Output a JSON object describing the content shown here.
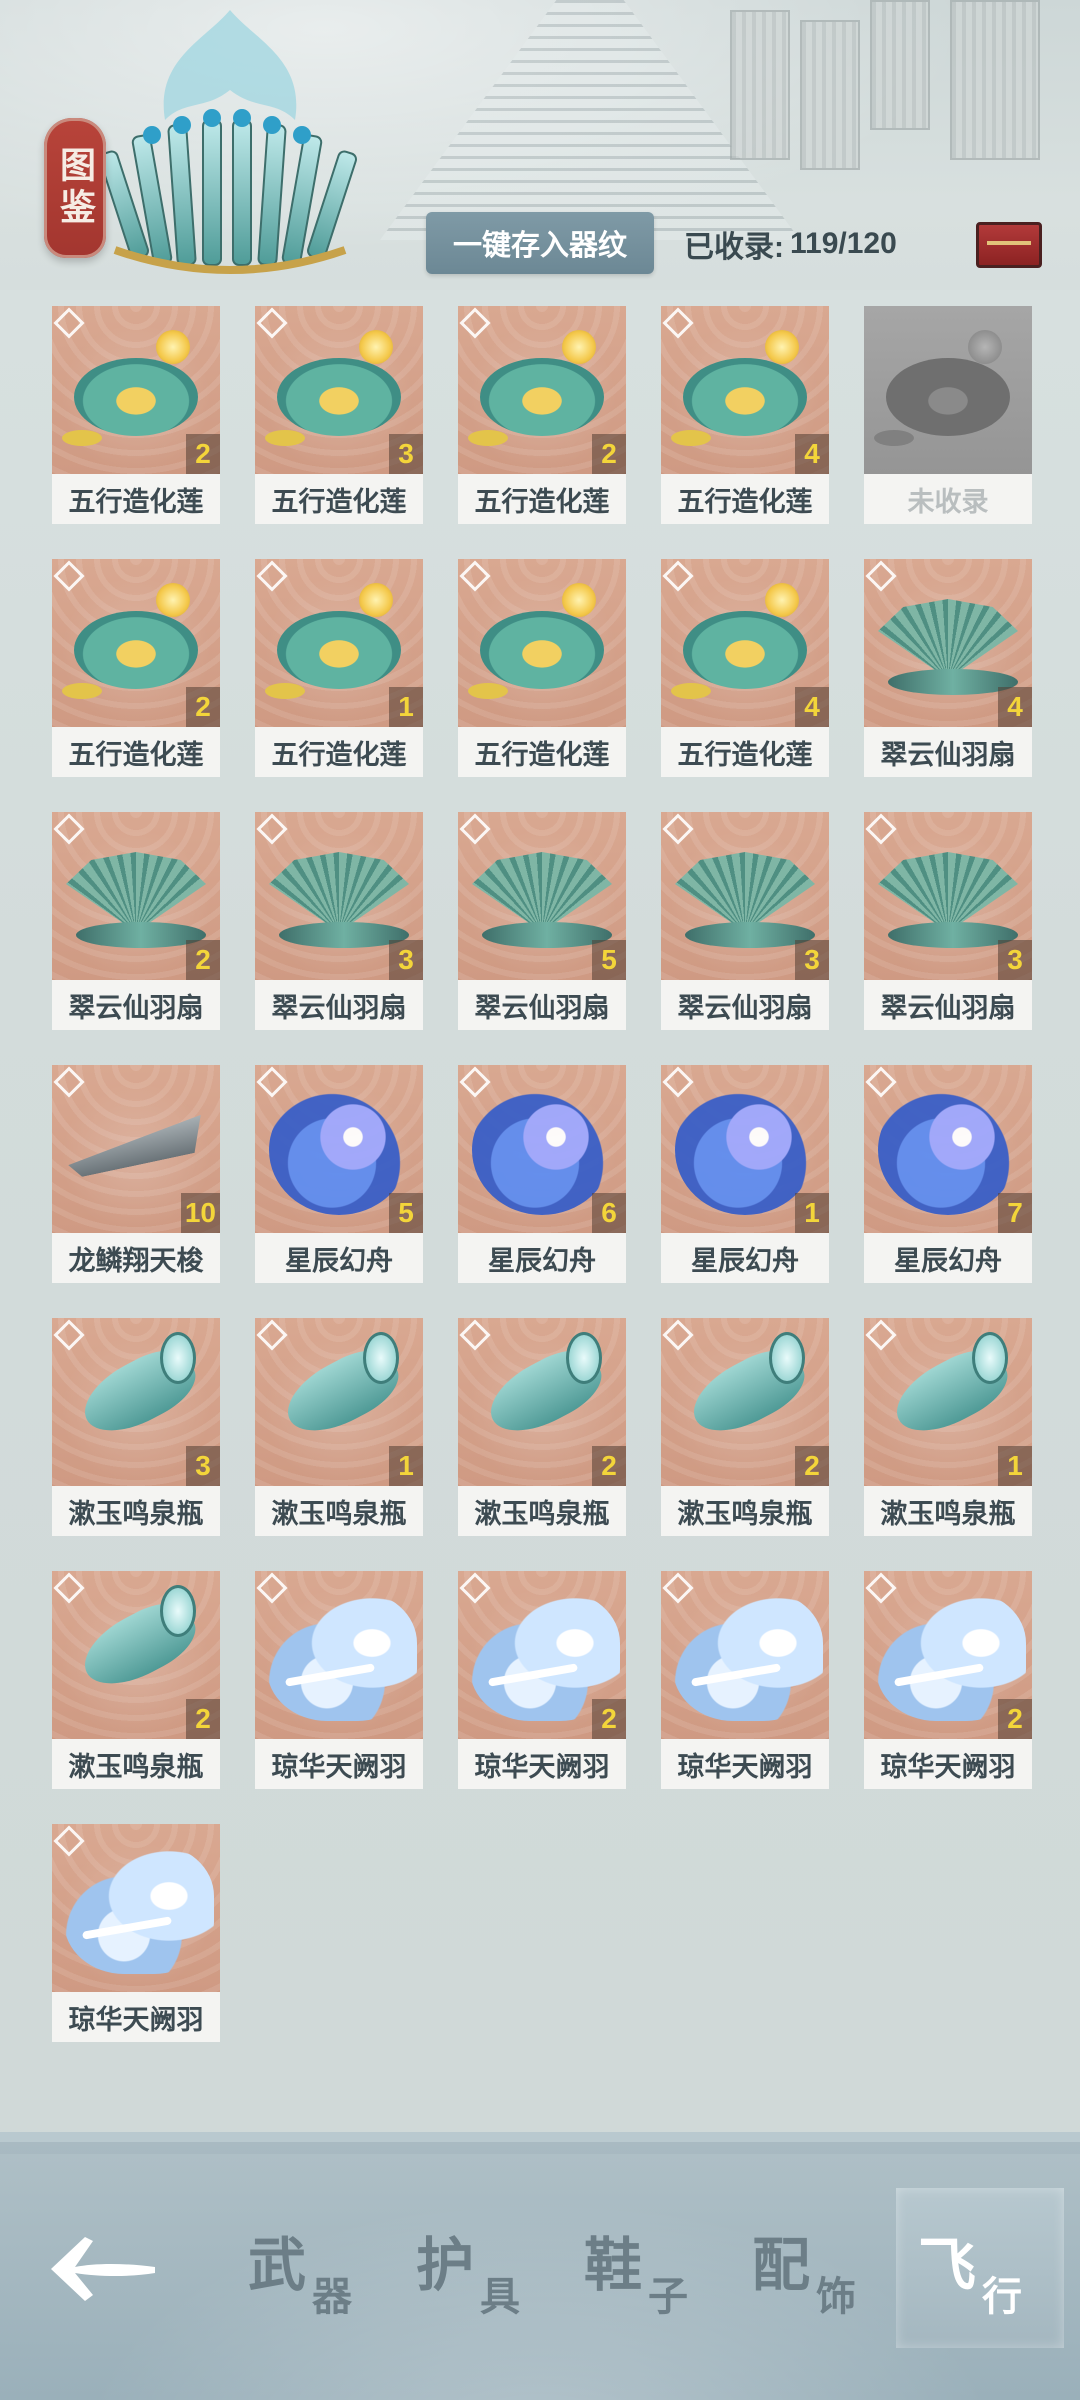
{
  "header": {
    "badge_label": "图鉴",
    "store_button_label": "一键存入器纹",
    "collected_label": "已收录:",
    "collected_count": "119/120"
  },
  "items": [
    {
      "name": "五行造化莲",
      "count": "2",
      "type": "lotus",
      "collected": true
    },
    {
      "name": "五行造化莲",
      "count": "3",
      "type": "lotus",
      "collected": true
    },
    {
      "name": "五行造化莲",
      "count": "2",
      "type": "lotus",
      "collected": true
    },
    {
      "name": "五行造化莲",
      "count": "4",
      "type": "lotus",
      "collected": true
    },
    {
      "name": "未收录",
      "count": "",
      "type": "lotus",
      "collected": false
    },
    {
      "name": "五行造化莲",
      "count": "2",
      "type": "lotus",
      "collected": true
    },
    {
      "name": "五行造化莲",
      "count": "1",
      "type": "lotus",
      "collected": true
    },
    {
      "name": "五行造化莲",
      "count": "",
      "type": "lotus",
      "collected": true
    },
    {
      "name": "五行造化莲",
      "count": "4",
      "type": "lotus",
      "collected": true
    },
    {
      "name": "翠云仙羽扇",
      "count": "4",
      "type": "fan",
      "collected": true
    },
    {
      "name": "翠云仙羽扇",
      "count": "2",
      "type": "fan",
      "collected": true
    },
    {
      "name": "翠云仙羽扇",
      "count": "3",
      "type": "fan",
      "collected": true
    },
    {
      "name": "翠云仙羽扇",
      "count": "5",
      "type": "fan",
      "collected": true
    },
    {
      "name": "翠云仙羽扇",
      "count": "3",
      "type": "fan",
      "collected": true
    },
    {
      "name": "翠云仙羽扇",
      "count": "3",
      "type": "fan",
      "collected": true
    },
    {
      "name": "龙鳞翔天梭",
      "count": "10",
      "type": "boat",
      "collected": true
    },
    {
      "name": "星辰幻舟",
      "count": "5",
      "type": "star",
      "collected": true
    },
    {
      "name": "星辰幻舟",
      "count": "6",
      "type": "star",
      "collected": true
    },
    {
      "name": "星辰幻舟",
      "count": "1",
      "type": "star",
      "collected": true
    },
    {
      "name": "星辰幻舟",
      "count": "7",
      "type": "star",
      "collected": true
    },
    {
      "name": "漱玉鸣泉瓶",
      "count": "3",
      "type": "vase",
      "collected": true
    },
    {
      "name": "漱玉鸣泉瓶",
      "count": "1",
      "type": "vase",
      "collected": true
    },
    {
      "name": "漱玉鸣泉瓶",
      "count": "2",
      "type": "vase",
      "collected": true
    },
    {
      "name": "漱玉鸣泉瓶",
      "count": "2",
      "type": "vase",
      "collected": true
    },
    {
      "name": "漱玉鸣泉瓶",
      "count": "1",
      "type": "vase",
      "collected": true
    },
    {
      "name": "漱玉鸣泉瓶",
      "count": "2",
      "type": "vase",
      "collected": true
    },
    {
      "name": "琼华天阙羽",
      "count": "",
      "type": "feather",
      "collected": true
    },
    {
      "name": "琼华天阙羽",
      "count": "2",
      "type": "feather",
      "collected": true
    },
    {
      "name": "琼华天阙羽",
      "count": "",
      "type": "feather",
      "collected": true
    },
    {
      "name": "琼华天阙羽",
      "count": "2",
      "type": "feather",
      "collected": true
    },
    {
      "name": "琼华天阙羽",
      "count": "",
      "type": "feather",
      "collected": true
    }
  ],
  "tabs": [
    {
      "big": "武",
      "small": "器",
      "active": false
    },
    {
      "big": "护",
      "small": "具",
      "active": false
    },
    {
      "big": "鞋",
      "small": "子",
      "active": false
    },
    {
      "big": "配",
      "small": "饰",
      "active": false
    },
    {
      "big": "飞",
      "small": "行",
      "active": true
    }
  ],
  "icons": {
    "back": "back-arrow-icon",
    "chest": "treasure-chest-icon"
  },
  "colors": {
    "count_text": "#f3d53a",
    "card_bg": "#d9a891",
    "badge": "#b8443a",
    "store_button": "#7f9aa6"
  }
}
